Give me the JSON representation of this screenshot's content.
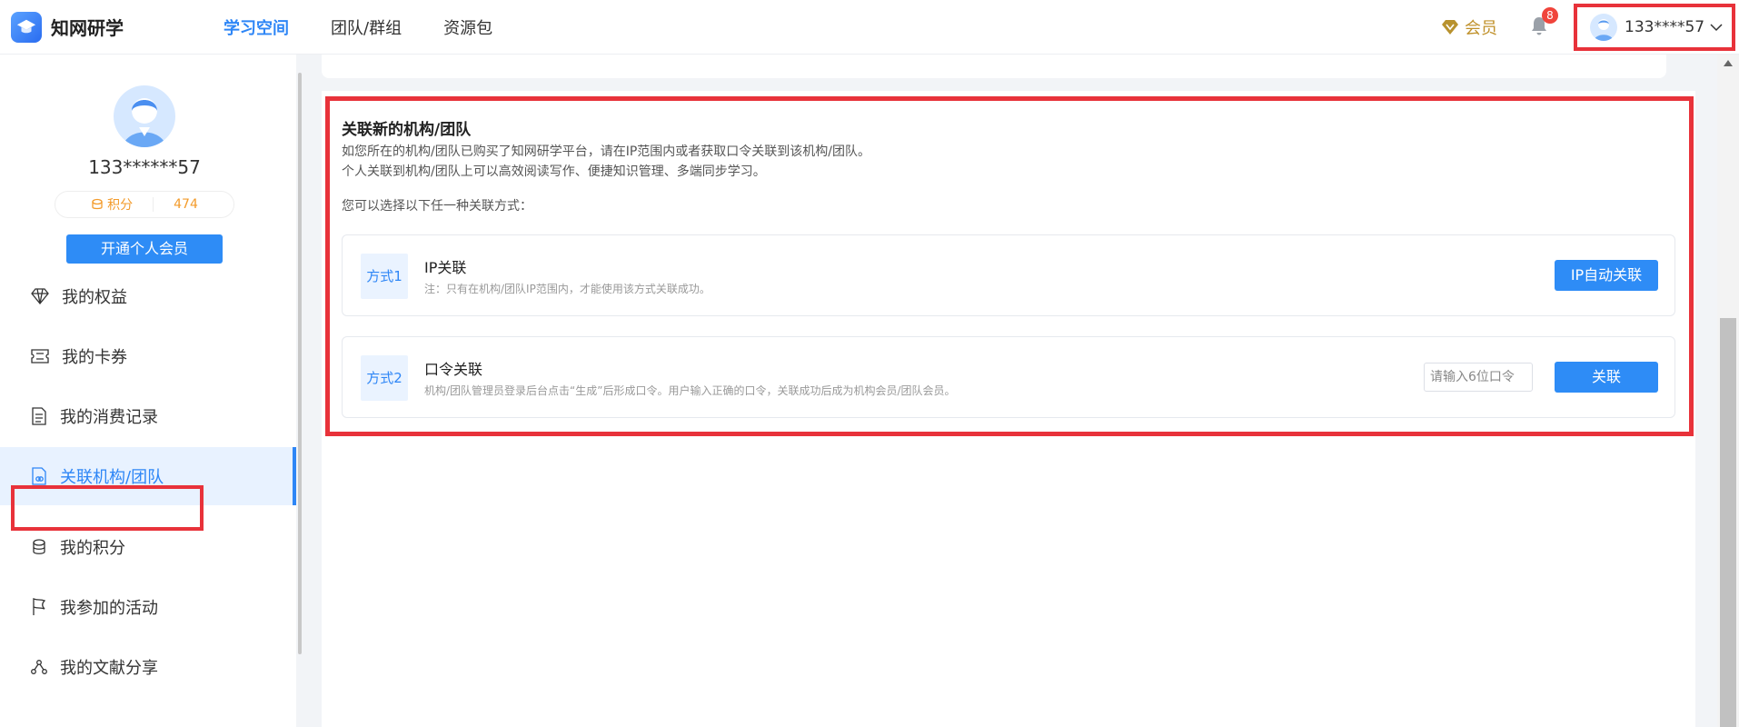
{
  "header": {
    "logo_text": "知网研学",
    "nav": [
      "学习空间",
      "团队/群组",
      "资源包"
    ],
    "active_nav": 0,
    "vip_label": "会员",
    "notification_count": "8",
    "user_name": "133****57"
  },
  "sidebar": {
    "profile_name": "133******57",
    "points_label": "积分",
    "points_value": "474",
    "vip_button": "开通个人会员",
    "menu": [
      {
        "label": "我的权益",
        "icon": "diamond-icon"
      },
      {
        "label": "我的卡券",
        "icon": "ticket-icon"
      },
      {
        "label": "我的消费记录",
        "icon": "document-icon"
      },
      {
        "label": "关联机构/团队",
        "icon": "link-document-icon",
        "active": true
      },
      {
        "label": "我的积分",
        "icon": "coins-icon"
      },
      {
        "label": "我参加的活动",
        "icon": "flag-icon"
      },
      {
        "label": "我的文献分享",
        "icon": "share-icon"
      }
    ]
  },
  "main": {
    "title": "关联新的机构/团队",
    "desc_line1": "如您所在的机构/团队已购买了知网研学平台，请在IP范围内或者获取口令关联到该机构/团队。",
    "desc_line2": "个人关联到机构/团队上可以高效阅读写作、便捷知识管理、多端同步学习。",
    "choose_text": "您可以选择以下任一种关联方式：",
    "method1": {
      "tag": "方式1",
      "title": "IP关联",
      "note": "注：只有在机构/团队IP范围内，才能使用该方式关联成功。",
      "button": "IP自动关联"
    },
    "method2": {
      "tag": "方式2",
      "title": "口令关联",
      "note": "机构/团队管理员登录后台点击“生成”后形成口令。用户输入正确的口令，关联成功后成为机构会员/团队会员。",
      "placeholder": "请输入6位口令",
      "value": "",
      "button": "关联"
    }
  },
  "colors": {
    "accent": "#2e86f6",
    "highlight": "#e8323a",
    "points": "#f39b2b",
    "vip": "#c0912b"
  }
}
